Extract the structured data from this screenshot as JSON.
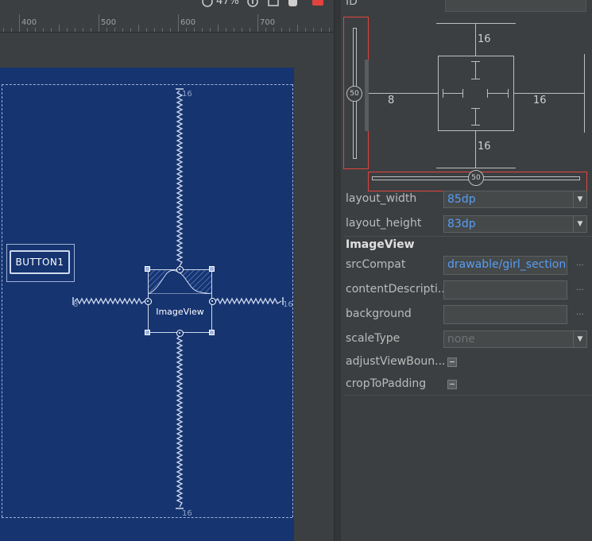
{
  "toolbar": {
    "zoom_text": "47%"
  },
  "ruler": {
    "ticks": [
      "400",
      "500",
      "600",
      "700"
    ]
  },
  "canvas": {
    "button_label": "BUTTON1",
    "imageview_label": "ImageView",
    "margin_top": "16",
    "margin_bottom": "16",
    "margin_left": "8",
    "margin_right": "16"
  },
  "constraint_widget": {
    "top_margin": "16",
    "bottom_margin": "16",
    "left_margin": "8",
    "right_margin": "16",
    "vertical_bias": "50",
    "horizontal_bias": "50"
  },
  "properties": {
    "id_label": "ID",
    "id_value": "",
    "layout_width_label": "layout_width",
    "layout_width_value": "85dp",
    "layout_height_label": "layout_height",
    "layout_height_value": "83dp",
    "section_title": "ImageView",
    "src_compat_label": "srcCompat",
    "src_compat_value": "drawable/girl_section",
    "content_description_label": "contentDescripti...",
    "content_description_value": "",
    "background_label": "background",
    "background_value": "",
    "scale_type_label": "scaleType",
    "scale_type_value": "none",
    "adjust_view_bounds_label": "adjustViewBoun...",
    "crop_to_padding_label": "cropToPadding",
    "ellipsis": "..."
  },
  "colors": {
    "canvas_bg": "#163470",
    "panel_bg": "#3c3f41",
    "link_blue": "#589df6",
    "highlight_red": "#e0443e"
  }
}
